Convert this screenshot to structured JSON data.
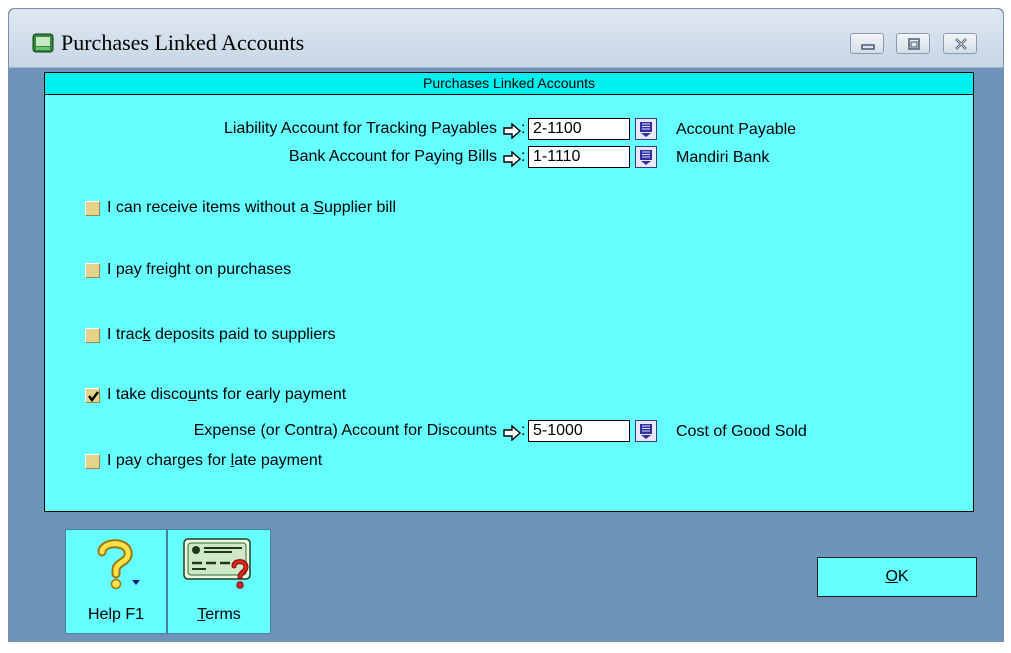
{
  "window": {
    "title": "Purchases Linked Accounts"
  },
  "panel": {
    "header": "Purchases Linked Accounts"
  },
  "accounts": {
    "liability": {
      "label": "Liability Account for Tracking Payables",
      "value": "2-1100",
      "name": "Account Payable"
    },
    "bank": {
      "label": "Bank Account for Paying Bills",
      "value": "1-1110",
      "name": "Mandiri Bank"
    },
    "discount": {
      "label": "Expense (or Contra) Account for Discounts",
      "value": "5-1000",
      "name": "Cost of Good Sold"
    }
  },
  "options": {
    "receive": {
      "pre": "I can receive items without a ",
      "key": "S",
      "post": "upplier bill",
      "checked": false
    },
    "freight": {
      "pre": "I pay freight on purchases",
      "key": "",
      "post": "",
      "checked": false
    },
    "deposits": {
      "pre": "I trac",
      "key": "k",
      "post": " deposits paid to suppliers",
      "checked": false
    },
    "discounts": {
      "pre": "I take disco",
      "key": "u",
      "post": "nts for early payment",
      "checked": true
    },
    "late": {
      "pre": "I pay charges for ",
      "key": "l",
      "post": "ate payment",
      "checked": false
    }
  },
  "colon": ":",
  "buttons": {
    "help": "Help F1",
    "terms_key": "T",
    "terms_rest": "erms",
    "ok_key": "O",
    "ok_rest": "K"
  },
  "icons": {
    "app": "window-app-icon",
    "arrow": "right-arrow-icon",
    "lookup": "list-lookup-icon",
    "help": "question-mark-icon",
    "terms": "card-question-icon"
  },
  "colors": {
    "frame": "#6f94b9",
    "panel": "#66ffff",
    "header": "#00f0f0",
    "checkbox": "#e5d38a"
  }
}
